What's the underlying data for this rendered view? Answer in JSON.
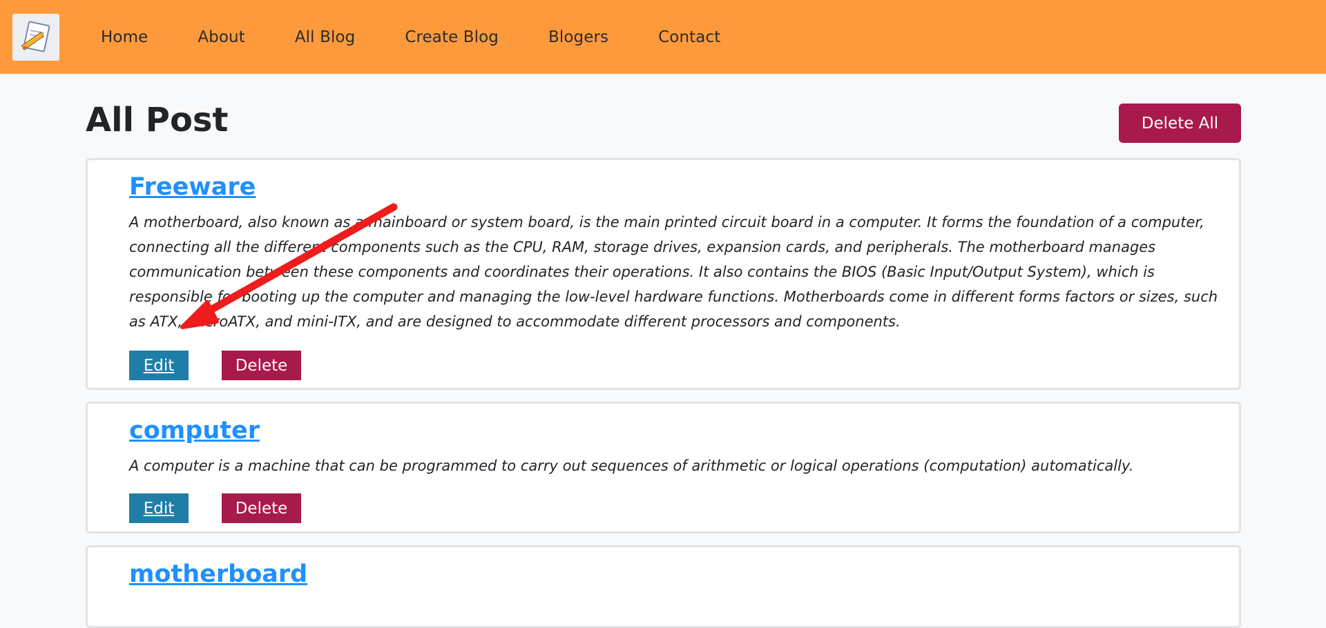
{
  "nav": {
    "logo_icon": "notepad-pencil-icon",
    "links": [
      "Home",
      "About",
      "All Blog",
      "Create Blog",
      "Blogers",
      "Contact"
    ]
  },
  "main": {
    "title": "All Post",
    "delete_all_label": "Delete All"
  },
  "posts": [
    {
      "title": "Freeware",
      "body": "A motherboard, also known as a mainboard or system board, is the main printed circuit board in a computer. It forms the foundation of a computer, connecting all the different components such as the CPU, RAM, storage drives, expansion cards, and peripherals. The motherboard manages communication between these components and coordinates their operations. It also contains the BIOS (Basic Input/Output System), which is responsible for booting up the computer and managing the low-level hardware functions. Motherboards come in different forms factors or sizes, such as ATX, microATX, and mini-ITX, and are designed to accommodate different processors and components.",
      "edit_label": "Edit",
      "delete_label": "Delete"
    },
    {
      "title": "computer",
      "body": "A computer is a machine that can be programmed to carry out sequences of arithmetic or logical operations (computation) automatically.",
      "edit_label": "Edit",
      "delete_label": "Delete"
    },
    {
      "title": "motherboard"
    }
  ],
  "colors": {
    "navbar": "#ff9a3c",
    "danger": "#a8194c",
    "edit": "#1f7ea7",
    "link": "#1e90ff",
    "annotation_arrow": "#ee1c1c"
  }
}
